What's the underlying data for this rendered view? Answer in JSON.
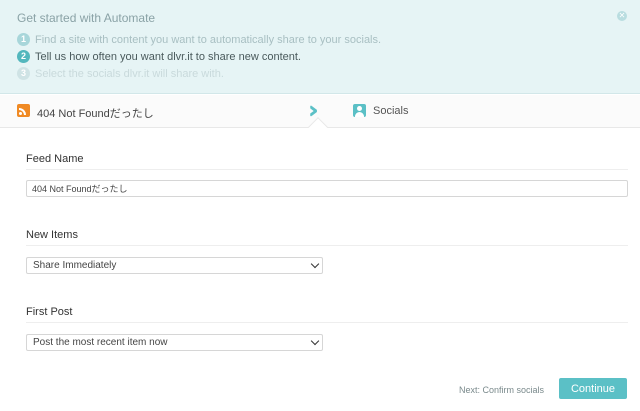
{
  "banner": {
    "title": "Get started with Automate",
    "close_icon": "close-icon",
    "steps": [
      {
        "num": "1",
        "text": "Find a site with content you want to automatically share to your socials."
      },
      {
        "num": "2",
        "text": "Tell us how often you want dlvr.it to share new content."
      },
      {
        "num": "3",
        "text": "Select the socials dlvr.it will share with."
      }
    ]
  },
  "wizard": {
    "feed_tab": {
      "label": "404 Not Foundだったし",
      "icon": "rss-icon"
    },
    "separator_icon": "double-chevron-right-icon",
    "socials_tab": {
      "label": "Socials",
      "icon": "user-icon"
    }
  },
  "form": {
    "feed_name": {
      "label": "Feed Name",
      "value": "404 Not Foundだったし"
    },
    "new_items": {
      "label": "New Items",
      "selected": "Share Immediately"
    },
    "first_post": {
      "label": "First Post",
      "selected": "Post the most recent item now"
    }
  },
  "footer": {
    "next_hint": "Next: Confirm socials",
    "continue_label": "Continue"
  },
  "colors": {
    "accent": "#5bc0c6",
    "banner_bg": "#e6f4f5",
    "rss": "#f08a24"
  }
}
